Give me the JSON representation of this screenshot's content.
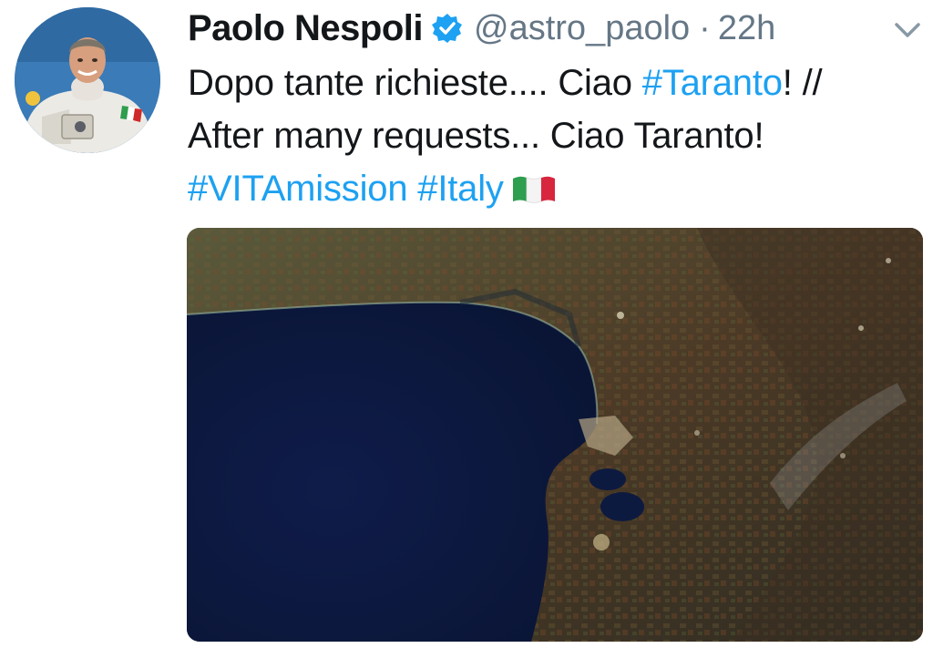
{
  "tweet": {
    "author": {
      "name": "Paolo Nespoli",
      "handle": "@astro_paolo",
      "verified": true
    },
    "separator": "·",
    "time": "22h",
    "text": {
      "line1": {
        "part1": "Dopo tante richieste.... Ciao ",
        "hashtag": "#Taranto",
        "part2": "! //"
      },
      "line2": "After many requests... Ciao Taranto!",
      "line3": {
        "hashtag1": "#VITAmission",
        "hashtag2": "#Italy"
      }
    },
    "emoji": "italy-flag",
    "media": {
      "kind": "satellite-photo"
    }
  },
  "colors": {
    "link": "#1da1f2",
    "text": "#14171a",
    "secondary": "#657786",
    "verified": "#1da1f2"
  }
}
